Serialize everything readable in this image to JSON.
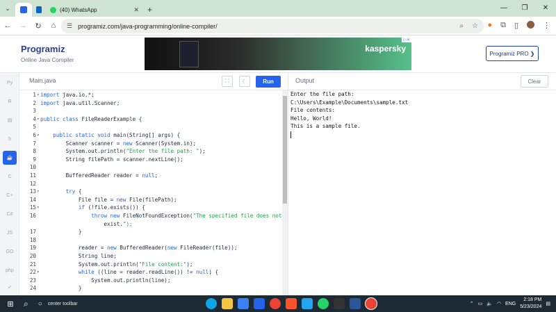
{
  "browser": {
    "tabs": [
      {
        "label": ""
      },
      {
        "label": ""
      },
      {
        "label": "(40) WhatsApp"
      }
    ],
    "url": "programiz.com/java-programming/online-compiler/"
  },
  "header": {
    "logo": "Programiz",
    "subtitle": "Online Java Compiler",
    "pro_button": "Programiz PRO ❯",
    "ad_brand": "kaspersky"
  },
  "languages": [
    "python",
    "r",
    "sql",
    "html",
    "java",
    "c",
    "cpp",
    "csharp",
    "js",
    "go",
    "php",
    "swift"
  ],
  "editor": {
    "filename": "Main.java",
    "run_label": "Run",
    "lines": [
      {
        "n": "1",
        "fold": true,
        "code": "import java.io.*;"
      },
      {
        "n": "2",
        "fold": false,
        "code": "import java.util.Scanner;"
      },
      {
        "n": "3",
        "fold": false,
        "code": ""
      },
      {
        "n": "4",
        "fold": true,
        "code": "public class FileReaderExample {"
      },
      {
        "n": "5",
        "fold": false,
        "code": ""
      },
      {
        "n": "6",
        "fold": true,
        "code": "    public static void main(String[] args) {"
      },
      {
        "n": "7",
        "fold": false,
        "code": "        Scanner scanner = new Scanner(System.in);"
      },
      {
        "n": "8",
        "fold": false,
        "code": "        System.out.println(\"Enter the file path: \");"
      },
      {
        "n": "9",
        "fold": false,
        "code": "        String filePath = scanner.nextLine();"
      },
      {
        "n": "10",
        "fold": false,
        "code": ""
      },
      {
        "n": "11",
        "fold": false,
        "code": "        BufferedReader reader = null;"
      },
      {
        "n": "12",
        "fold": false,
        "code": ""
      },
      {
        "n": "13",
        "fold": true,
        "code": "        try {"
      },
      {
        "n": "14",
        "fold": false,
        "code": "            File file = new File(filePath);"
      },
      {
        "n": "15",
        "fold": true,
        "code": "            if (!file.exists()) {"
      },
      {
        "n": "16",
        "fold": false,
        "code": "                throw new FileNotFoundException(\"The specified file does not"
      },
      {
        "n": "",
        "fold": false,
        "code": "                    exist.\");"
      },
      {
        "n": "17",
        "fold": false,
        "code": "            }"
      },
      {
        "n": "18",
        "fold": false,
        "code": ""
      },
      {
        "n": "19",
        "fold": false,
        "code": "            reader = new BufferedReader(new FileReader(file));"
      },
      {
        "n": "20",
        "fold": false,
        "code": "            String line;"
      },
      {
        "n": "21",
        "fold": false,
        "code": "            System.out.println(\"File content:\");"
      },
      {
        "n": "22",
        "fold": true,
        "code": "            while ((line = reader.readLine()) != null) {"
      },
      {
        "n": "23",
        "fold": false,
        "code": "                System.out.println(line);"
      },
      {
        "n": "24",
        "fold": false,
        "code": "            }"
      }
    ]
  },
  "output": {
    "label": "Output",
    "clear_label": "Clear",
    "lines": [
      "Enter the file path:",
      "C:\\Users\\Example\\Documents\\sample.txt",
      "File contents:",
      "Hello, World!",
      "This is a sample file."
    ]
  },
  "taskbar": {
    "search_label": "center toolbar",
    "lang": "ENG",
    "time": "2:18 PM",
    "date": "5/23/2024"
  }
}
